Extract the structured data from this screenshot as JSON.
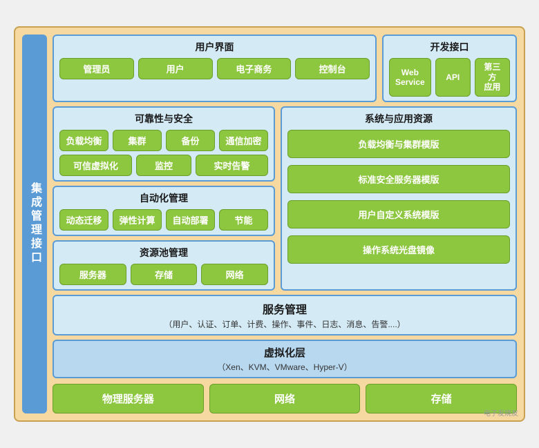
{
  "leftLabel": "集成管理接口",
  "userInterface": {
    "title": "用户界面",
    "buttons": [
      "管理员",
      "用户",
      "电子商务",
      "控制台"
    ]
  },
  "devInterface": {
    "title": "开发接口",
    "buttons": [
      "Web\nService",
      "API",
      "第三方\n应用"
    ]
  },
  "reliability": {
    "title": "可靠性与安全",
    "row1": [
      "负载均衡",
      "集群",
      "备份",
      "通信加密"
    ],
    "row2": [
      "可信虚拟化",
      "监控",
      "实时告警"
    ]
  },
  "autoManage": {
    "title": "自动化管理",
    "buttons": [
      "动态迁移",
      "弹性计算",
      "自动部署",
      "节能"
    ]
  },
  "resourcePool": {
    "title": "资源池管理",
    "buttons": [
      "服务器",
      "存储",
      "网络"
    ]
  },
  "sysResources": {
    "title": "系统与应用资源",
    "buttons": [
      "负载均衡与集群模版",
      "标准安全服务器模版",
      "用户自定义系统模版",
      "操作系统光盘镜像"
    ]
  },
  "serviceManage": {
    "title": "服务管理",
    "sub": "（用户、认证、订单、计费、操作、事件、日志、消息、告警....）"
  },
  "virtualization": {
    "title": "虚拟化层",
    "sub": "（Xen、KVM、VMware、Hyper-V）"
  },
  "bottomItems": [
    "物理服务器",
    "网络",
    "存储"
  ],
  "watermark": "电子发烧友"
}
